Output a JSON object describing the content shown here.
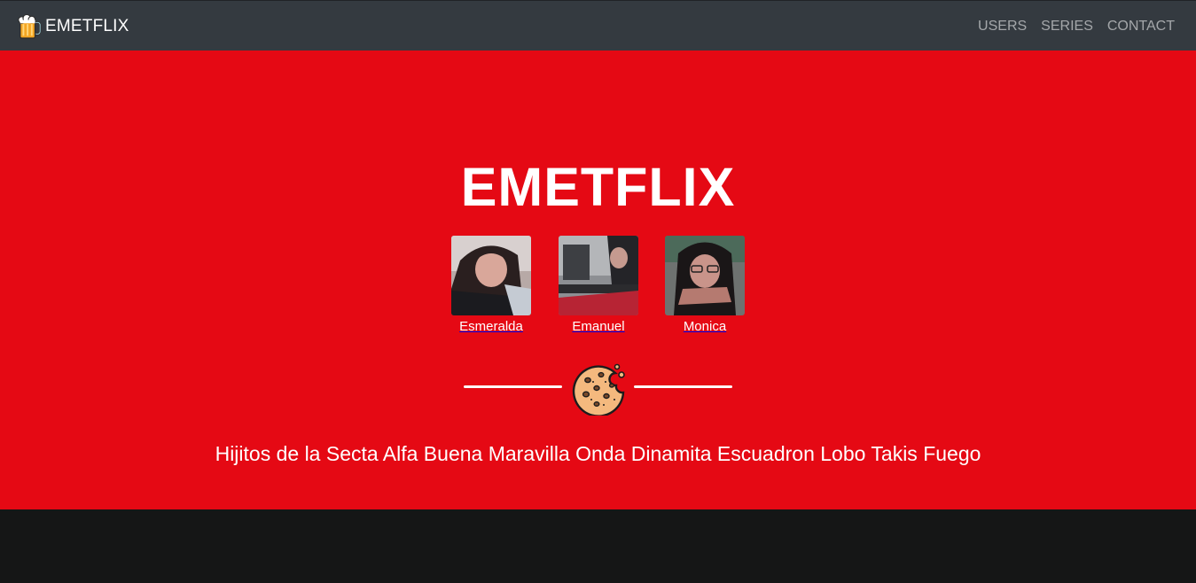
{
  "navbar": {
    "brand": {
      "icon": "beer-mug-icon",
      "text": "EMETFLIX"
    },
    "links": [
      {
        "label": "USERS"
      },
      {
        "label": "SERIES"
      },
      {
        "label": "CONTACT"
      }
    ]
  },
  "hero": {
    "title": "EMETFLIX",
    "profiles": [
      {
        "name": "Esmeralda"
      },
      {
        "name": "Emanuel"
      },
      {
        "name": "Monica"
      }
    ],
    "divider_icon": "cookie-icon",
    "tagline": "Hijitos de la Secta Alfa Buena Maravilla Onda Dinamita Escuadron Lobo Takis Fuego"
  },
  "colors": {
    "navbar": "#343a40",
    "hero": "#e50914",
    "footer": "#151616",
    "text": "#ffffff",
    "nav_link": "#a8aaac"
  }
}
